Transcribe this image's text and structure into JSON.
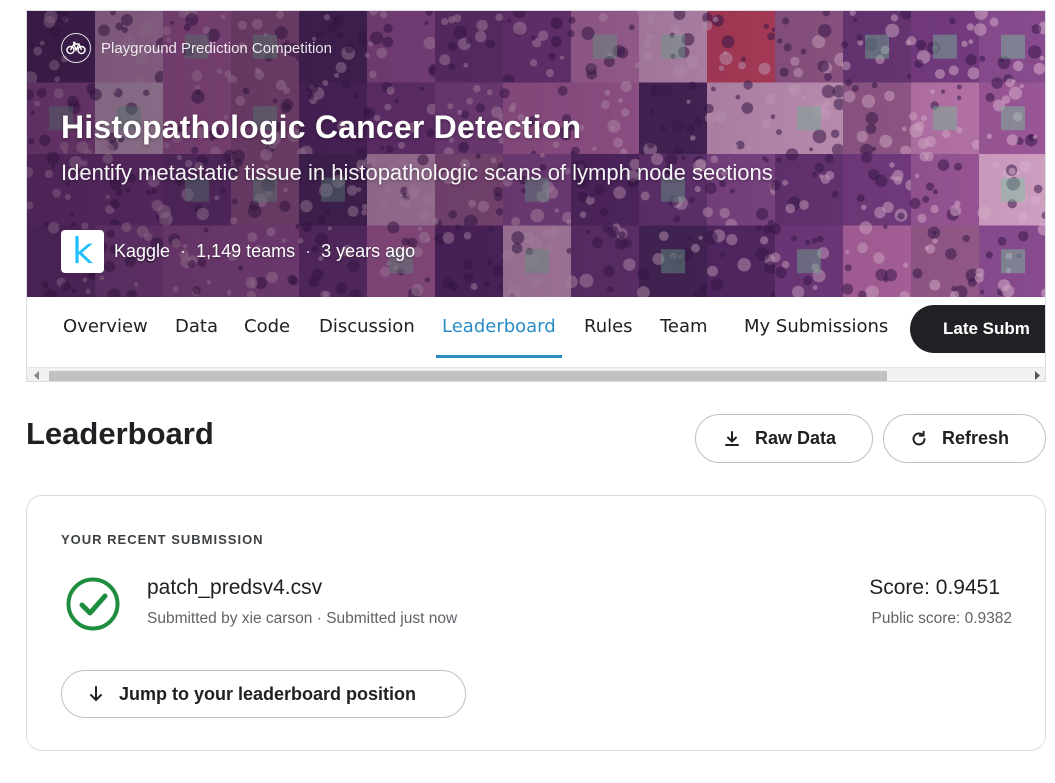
{
  "hero": {
    "competition_type": "Playground Prediction Competition",
    "competition_type_icon": "bicycle-icon",
    "title": "Histopathologic Cancer Detection",
    "subtitle": "Identify metastatic tissue in histopathologic scans of lymph node sections",
    "host_logo_letter": "k",
    "host": "Kaggle",
    "separator": "·",
    "teams": "1,149 teams",
    "age": "3 years ago"
  },
  "tabs": [
    {
      "label": "Overview"
    },
    {
      "label": "Data"
    },
    {
      "label": "Code"
    },
    {
      "label": "Discussion"
    },
    {
      "label": "Leaderboard",
      "active": true
    },
    {
      "label": "Rules"
    },
    {
      "label": "Team"
    },
    {
      "label": "My Submissions"
    }
  ],
  "late_submission_label": "Late Subm",
  "page": {
    "title": "Leaderboard",
    "raw_data_label": "Raw Data",
    "refresh_label": "Refresh"
  },
  "submission": {
    "section_label": "YOUR RECENT SUBMISSION",
    "status_icon": "success-check-icon",
    "file_name": "patch_predsv4.csv",
    "meta": "Submitted by xie carson · Submitted just now",
    "score": "Score: 0.9451",
    "public_score": "Public score: 0.9382",
    "jump_label": "Jump to your leaderboard position"
  },
  "colors": {
    "accent": "#2b8dc8",
    "success": "#1e8e3e",
    "dark_button": "#202124",
    "kaggle_blue": "#20beff"
  }
}
